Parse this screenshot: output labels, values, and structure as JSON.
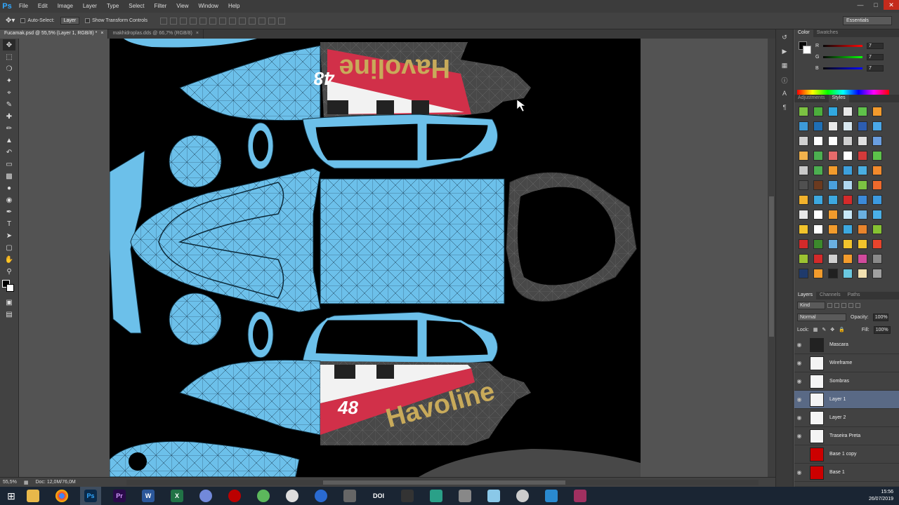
{
  "app": {
    "logo": "Ps"
  },
  "menu": [
    "File",
    "Edit",
    "Image",
    "Layer",
    "Type",
    "Select",
    "Filter",
    "View",
    "Window",
    "Help"
  ],
  "options": {
    "auto_select_label": "Auto-Select:",
    "auto_select_value": "Layer",
    "transform_label": "Show Transform Controls",
    "workspace": "Essentials"
  },
  "tabs": [
    {
      "label": "Fucamak.psd @ 55,5% (Layer 1, RGB/8) *"
    },
    {
      "label": "makhidroplas.dds @ 66,7% (RGB/8)"
    }
  ],
  "status": {
    "zoom": "55,5%",
    "doc": "Doc: 12,0M/76,0M"
  },
  "color_panel": {
    "tabs": [
      "Color",
      "Swatches"
    ],
    "r_label": "R",
    "r": "7",
    "g_label": "G",
    "g": "7",
    "b_label": "B",
    "b": "7"
  },
  "styles_panel": {
    "tabs": [
      "Adjustments",
      "Styles"
    ],
    "swatches": [
      "#7cc242",
      "#4cae3c",
      "#31a8e0",
      "#e8e8e8",
      "#5fc24a",
      "#f39a2c",
      "#3d9ad8",
      "#1f6fb5",
      "#e8e8e8",
      "#d8e8f0",
      "#2d5db0",
      "#4aa8e8",
      "#d0d0d0",
      "#ffffff",
      "#ffffff",
      "#d0d0d0",
      "#e0e0e0",
      "#6a9ee0",
      "#f2b24c",
      "#4caf50",
      "#e66b6b",
      "#ffffff",
      "#d23a3a",
      "#5cc24a",
      "#c8c8c8",
      "#4caf50",
      "#f29b2c",
      "#3da0dc",
      "#4aaee0",
      "#f28a2c",
      "#505050",
      "#6b3a1f",
      "#4aa0dc",
      "#b0d8f0",
      "#7cc242",
      "#f06a2c",
      "#f2b22c",
      "#3da8e0",
      "#3da8e0",
      "#d42a2a",
      "#3c8ad8",
      "#3c9ae0",
      "#e8e8e8",
      "#ffffff",
      "#f29b2c",
      "#c8e8f8",
      "#6ab0e0",
      "#4ab0e8",
      "#f2c42c",
      "#ffffff",
      "#f29b2c",
      "#3da8e0",
      "#e8842c",
      "#86c232",
      "#d42a2a",
      "#3c8a2c",
      "#6ab0e0",
      "#f2c42c",
      "#f2c42c",
      "#e8442c",
      "#9cc232",
      "#d42a2a",
      "#d0d0d0",
      "#f29b2c",
      "#d04a9c",
      "#8a8a8a",
      "#1f3a6b",
      "#f29b2c",
      "#202020",
      "#6ac8e0",
      "#f2e0b0",
      "#a0a0a0"
    ]
  },
  "layers_panel": {
    "tabs": [
      "Layers",
      "Channels",
      "Paths"
    ],
    "kind": "Kind",
    "blend": "Normal",
    "opacity_label": "Opacity:",
    "opacity": "100%",
    "lock_label": "Lock:",
    "fill_label": "Fill:",
    "fill": "100%",
    "layers": [
      {
        "name": "Mascara",
        "thumb": "#222",
        "visible": true
      },
      {
        "name": "Wireframe",
        "thumb": "#f4f4f4",
        "visible": true
      },
      {
        "name": "Sombras",
        "thumb": "#f4f4f4",
        "visible": true
      },
      {
        "name": "Layer 1",
        "thumb": "#f4f4f4",
        "visible": true
      },
      {
        "name": "Layer 2",
        "thumb": "#f4f4f4",
        "visible": true
      },
      {
        "name": "Traseira Preta",
        "thumb": "#f4f4f4",
        "visible": true
      },
      {
        "name": "Base 1 copy",
        "thumb": "#cc0000",
        "visible": false
      },
      {
        "name": "Base 1",
        "thumb": "#cc0000",
        "visible": true
      }
    ]
  },
  "canvas": {
    "sponsor_text": "Havoline",
    "number_text": "48"
  },
  "taskbar": {
    "time": "15:56",
    "date": "26/07/2019",
    "apps": [
      "W",
      "X",
      "DOI"
    ]
  }
}
